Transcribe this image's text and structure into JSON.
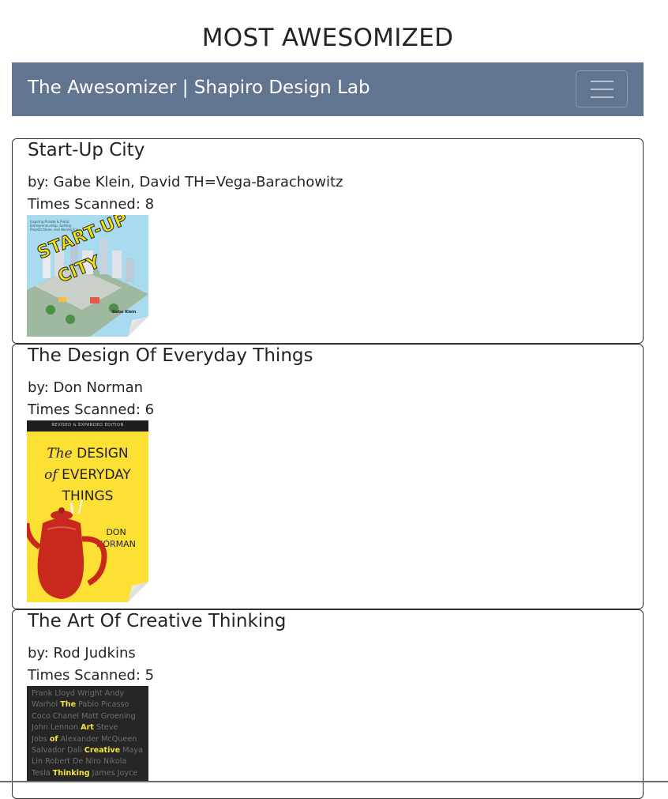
{
  "page": {
    "title": "MOST AWESOMIZED"
  },
  "navbar": {
    "brand": "The Awesomizer | Shapiro Design Lab",
    "toggle_icon": "hamburger-menu-icon",
    "background_color": "#627590"
  },
  "books": [
    {
      "title": "Start-Up City",
      "authors_line": "by: Gabe Klein, David TH=Vega-Barachowitz",
      "scans_line": "Times Scanned: 8",
      "cover": {
        "tagline": "Inspiring Private & Public Entrepreneurship, Getting Projects Done, and Having Fun",
        "title_line1": "START-UP",
        "title_line2": "CITY",
        "author_small": "Gabe Klein"
      }
    },
    {
      "title": "The Design Of Everyday Things",
      "authors_line": "by: Don Norman",
      "scans_line": "Times Scanned: 6",
      "cover": {
        "edition": "REVISED & EXPANDED EDITION",
        "line1_italic": "The",
        "line1": "DESIGN",
        "line2_italic": "of",
        "line2": "EVERYDAY",
        "line3": "THINGS",
        "author1": "DON",
        "author2": "NORMAN"
      }
    },
    {
      "title": "The Art Of Creative Thinking",
      "authors_line": "by: Rod Judkins",
      "scans_line": "Times Scanned: 5",
      "cover": {
        "lines": [
          [
            {
              "t": "Frank Lloyd Wright Andy",
              "h": false
            }
          ],
          [
            {
              "t": "Warhol ",
              "h": false
            },
            {
              "t": "The",
              "h": true
            },
            {
              "t": " Pablo Picasso",
              "h": false
            }
          ],
          [
            {
              "t": "Coco Chanel Matt Groening",
              "h": false
            }
          ],
          [
            {
              "t": "John Lennon ",
              "h": false
            },
            {
              "t": "Art",
              "h": true
            },
            {
              "t": " Steve",
              "h": false
            }
          ],
          [
            {
              "t": "Jobs ",
              "h": false
            },
            {
              "t": "of",
              "h": true
            },
            {
              "t": " Alexander McQueen",
              "h": false
            }
          ],
          [
            {
              "t": "Salvador Dali ",
              "h": false
            },
            {
              "t": "Creative",
              "h": true
            },
            {
              "t": " Maya",
              "h": false
            }
          ],
          [
            {
              "t": "Lin Robert De Niro Nikola",
              "h": false
            }
          ],
          [
            {
              "t": "Tesla ",
              "h": false
            },
            {
              "t": "Thinking",
              "h": true
            },
            {
              "t": " James Joyce",
              "h": false
            }
          ]
        ]
      }
    }
  ]
}
